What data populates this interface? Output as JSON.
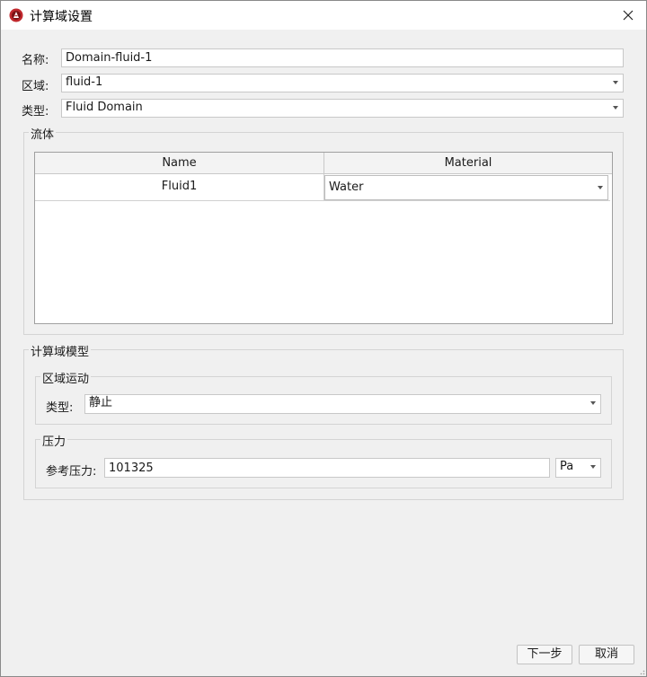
{
  "window": {
    "title": "计算域设置",
    "app_icon": "app-logo-icon",
    "close_icon": "close-icon"
  },
  "form": {
    "name_label": "名称:",
    "name_value": "Domain-fluid-1",
    "region_label": "区域:",
    "region_value": "fluid-1",
    "type_label": "类型:",
    "type_value": "Fluid Domain"
  },
  "fluid_group": {
    "title": "流体",
    "columns": [
      "Name",
      "Material"
    ],
    "rows": [
      {
        "name": "Fluid1",
        "material": "Water"
      }
    ]
  },
  "model_group": {
    "title": "计算域模型",
    "motion": {
      "title": "区域运动",
      "type_label": "类型:",
      "type_value": "静止"
    },
    "pressure": {
      "title": "压力",
      "ref_label": "参考压力:",
      "ref_value": "101325",
      "unit_value": "Pa"
    }
  },
  "footer": {
    "next_label": "下一步",
    "cancel_label": "取消"
  }
}
